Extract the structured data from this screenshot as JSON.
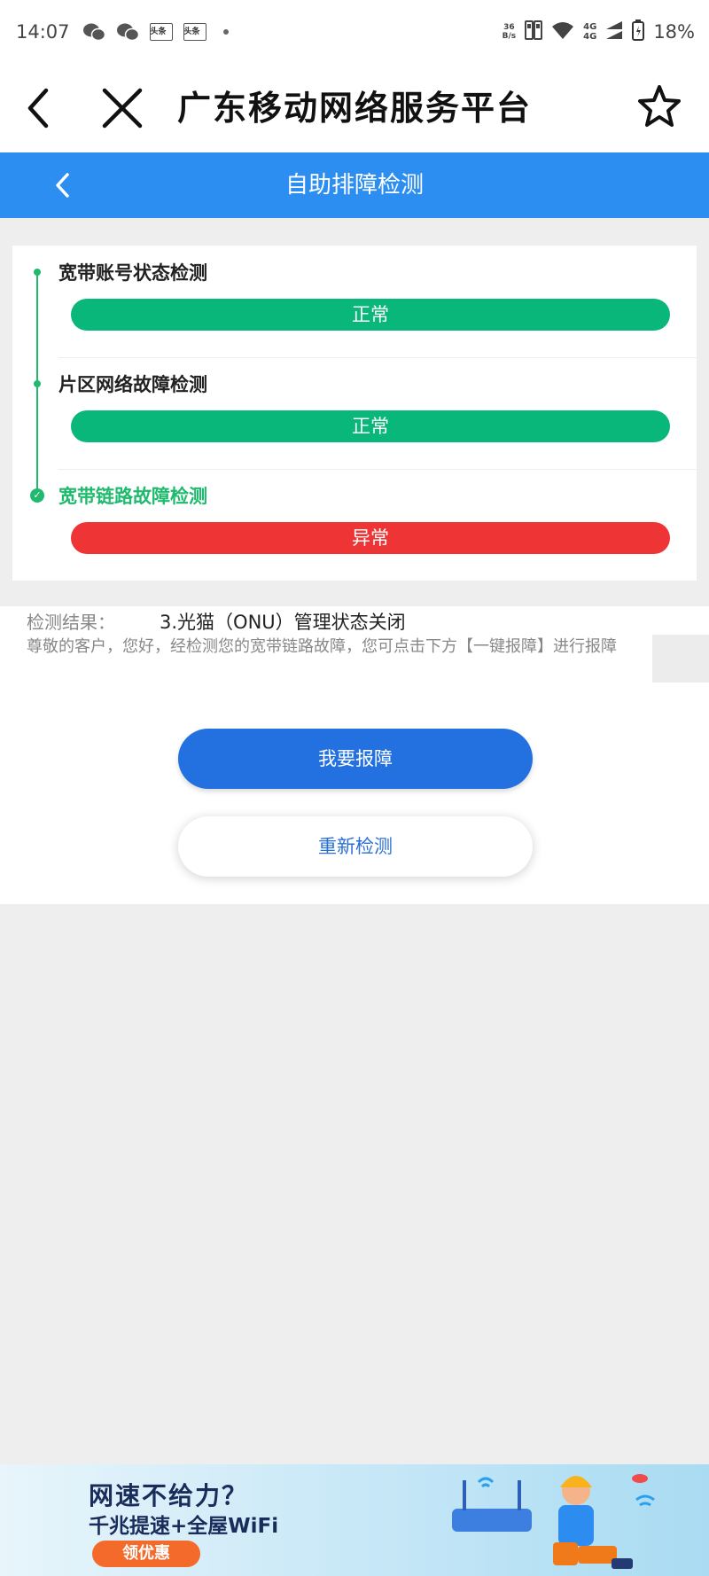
{
  "status_bar": {
    "time": "14:07",
    "app_badges": [
      "头条",
      "头条"
    ],
    "net_speed_value": "36",
    "net_speed_unit": "B/s",
    "gen_top": "4G",
    "gen_bottom": "4G",
    "battery": "18%"
  },
  "titlebar": {
    "title": "广东移动网络服务平台"
  },
  "header": {
    "title": "自助排障检测"
  },
  "checks": [
    {
      "title": "宽带账号状态检测",
      "status": "正常"
    },
    {
      "title": "片区网络故障检测",
      "status": "正常"
    },
    {
      "title": "宽带链路故障检测",
      "status": "异常"
    }
  ],
  "result": {
    "label": "检测结果：",
    "value": "3.光猫（ONU）管理状态关闭",
    "description": "尊敬的客户，您好，经检测您的宽带链路故障，您可点击下方【一键报障】进行报障"
  },
  "buttons": {
    "report": "我要报障",
    "recheck": "重新检测"
  },
  "banner": {
    "headline": "网速不给力？",
    "subline": "千兆提速+全屋WiFi",
    "cta": "领优惠"
  },
  "colors": {
    "brand_blue": "#2b8ef0",
    "ok_green": "#08b779",
    "error_red": "#ee3434",
    "button_blue": "#2370e0"
  }
}
